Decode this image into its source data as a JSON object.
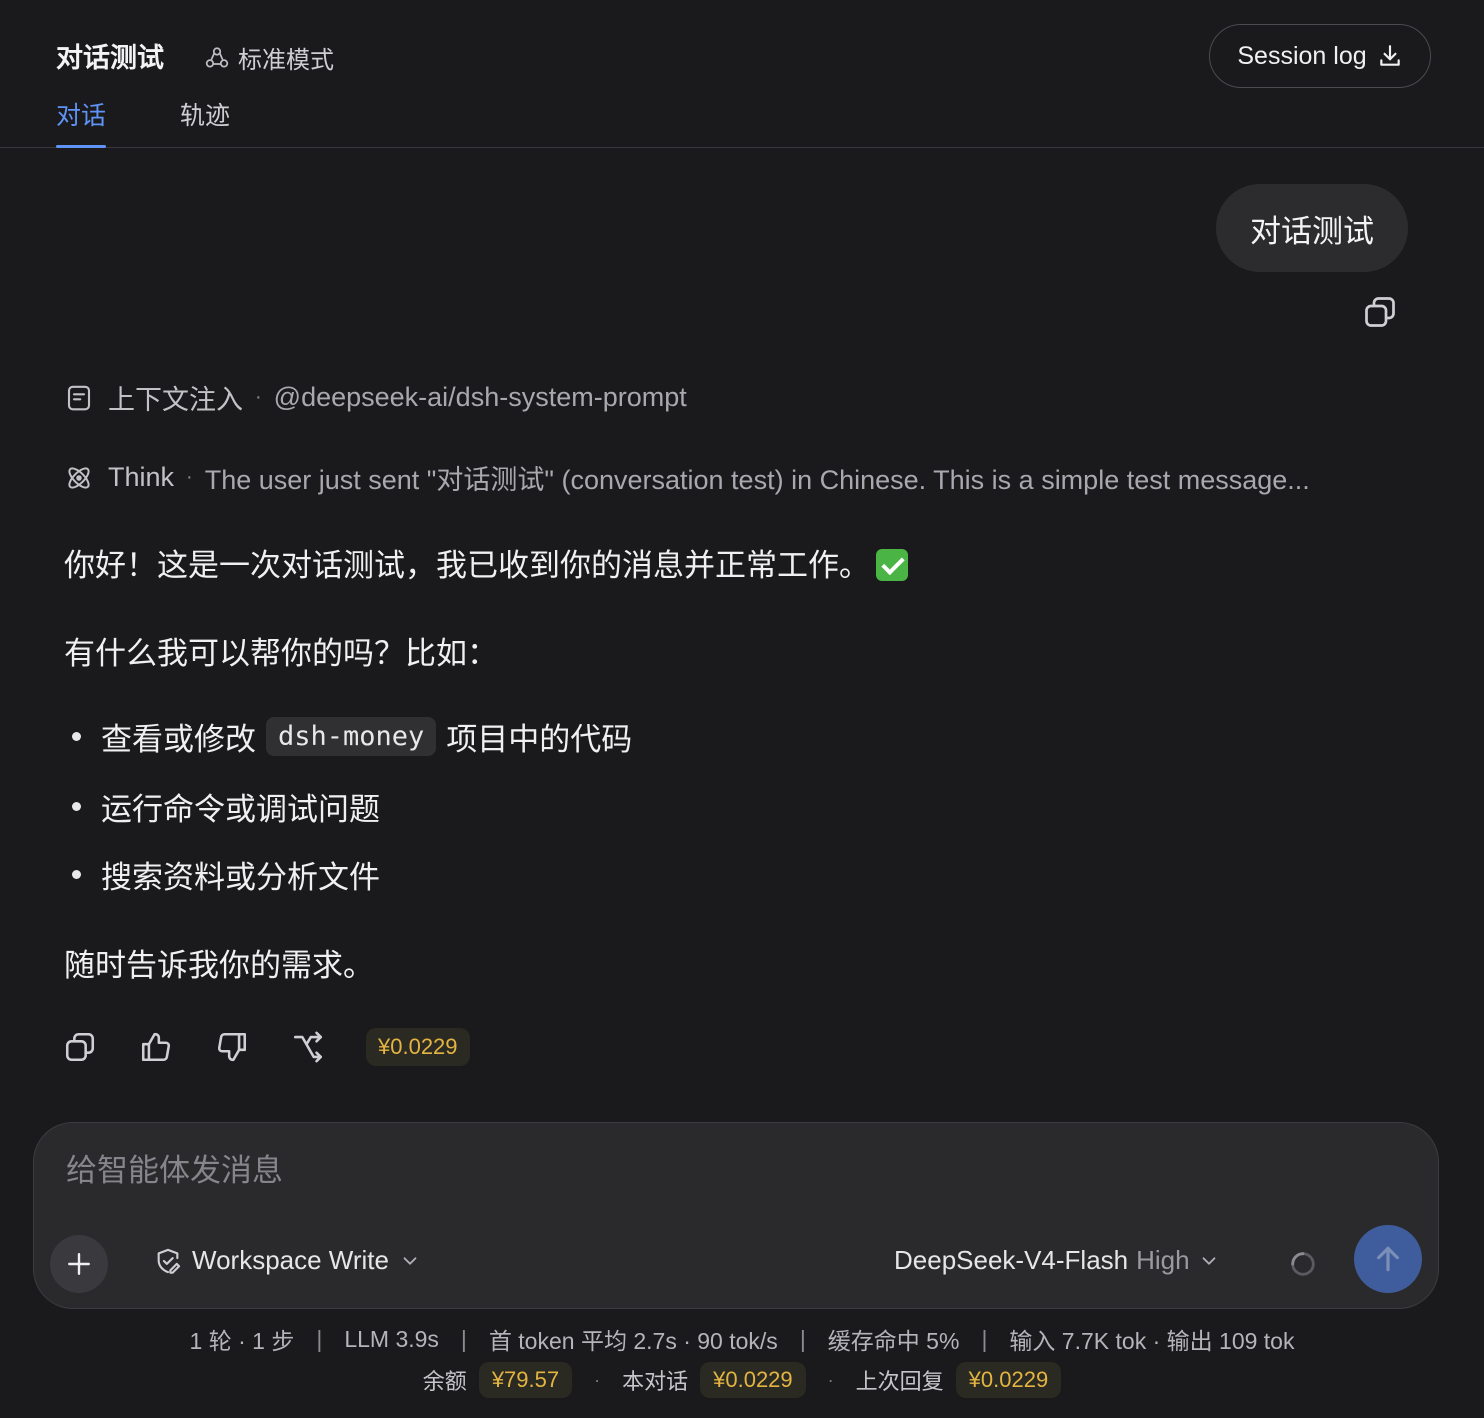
{
  "header": {
    "title": "对话测试",
    "mode_label": "标准模式",
    "session_log_label": "Session log",
    "tabs": [
      {
        "label": "对话",
        "active": true
      },
      {
        "label": "轨迹",
        "active": false
      }
    ]
  },
  "user_message": {
    "text": "对话测试"
  },
  "context_injection": {
    "label": "上下文注入",
    "value": "@deepseek-ai/dsh-system-prompt"
  },
  "think": {
    "label": "Think",
    "preview": "The user just sent \"对话测试\" (conversation test) in Chinese. This is a simple test message..."
  },
  "assistant": {
    "greeting": "你好！这是一次对话测试，我已收到你的消息并正常工作。",
    "question": "有什么我可以帮你的吗？比如：",
    "bullets": [
      {
        "before": "查看或修改",
        "code": "dsh-money",
        "after": "项目中的代码"
      },
      {
        "text": "运行命令或调试问题"
      },
      {
        "text": "搜索资料或分析文件"
      }
    ],
    "closing": "随时告诉我你的需求。",
    "cost": "¥0.0229"
  },
  "composer": {
    "placeholder": "给智能体发消息",
    "permission_label": "Workspace Write",
    "model_name": "DeepSeek-V4-Flash",
    "model_effort": "High"
  },
  "stats": {
    "turns": "1 轮 · 1 步",
    "llm": "LLM 3.9s",
    "first_token": "首 token 平均 2.7s · 90 tok/s",
    "cache": "缓存命中 5%",
    "tokens": "输入 7.7K tok · 输出 109 tok",
    "balance_label": "余额",
    "balance": "¥79.57",
    "conversation_label": "本对话",
    "conversation_cost": "¥0.0229",
    "last_reply_label": "上次回复",
    "last_reply_cost": "¥0.0229"
  },
  "colors": {
    "accent": "#5f93f5",
    "cost": "#e3b441",
    "send": "#3f5d9c",
    "background": "#1a1a1c"
  }
}
